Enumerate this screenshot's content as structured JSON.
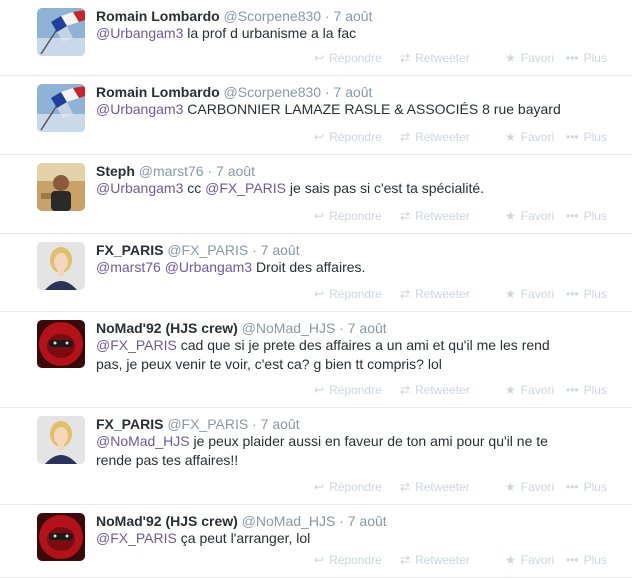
{
  "tweets": [
    {
      "name": "Romain Lombardo",
      "handle": "@Scorpene830",
      "date": "7 août",
      "avatar": "flag-france-avatar",
      "text": [
        {
          "t": "@Urbangam3",
          "m": true
        },
        {
          "t": " la prof d urbanisme a la fac",
          "m": false
        }
      ]
    },
    {
      "name": "Romain Lombardo",
      "handle": "@Scorpene830",
      "date": "7 août",
      "avatar": "flag-france-avatar",
      "text": [
        {
          "t": "@Urbangam3",
          "m": true
        },
        {
          "t": " CARBONNIER LAMAZE RASLE & ASSOCIÉS 8 rue bayard",
          "m": false
        }
      ]
    },
    {
      "name": "Steph",
      "handle": "@marst76",
      "date": "7 août",
      "avatar": "person-photo-avatar",
      "text": [
        {
          "t": "@Urbangam3",
          "m": true
        },
        {
          "t": " cc ",
          "m": false
        },
        {
          "t": "@FX_PARIS",
          "m": true
        },
        {
          "t": " je sais pas si c'est ta spécialité.",
          "m": false
        }
      ]
    },
    {
      "name": "FX_PARIS",
      "handle": "@FX_PARIS",
      "date": "7 août",
      "avatar": "blonde-woman-avatar",
      "text": [
        {
          "t": "@marst76",
          "m": true
        },
        {
          "t": " ",
          "m": false
        },
        {
          "t": "@Urbangam3",
          "m": true
        },
        {
          "t": " Droit des affaires.",
          "m": false
        }
      ]
    },
    {
      "name": "NoMad'92 (HJS crew)",
      "handle": "@NoMad_HJS",
      "date": "7 août",
      "avatar": "red-keffiyeh-avatar",
      "text": [
        {
          "t": "@FX_PARIS",
          "m": true
        },
        {
          "t": " cad que si je prete des affaires a un ami et qu'il me les rend pas, je peux venir te voir, c'est ca? g bien tt compris? lol",
          "m": false
        }
      ]
    },
    {
      "name": "FX_PARIS",
      "handle": "@FX_PARIS",
      "date": "7 août",
      "avatar": "blonde-woman-avatar",
      "text": [
        {
          "t": "@NoMad_HJS",
          "m": true
        },
        {
          "t": " je peux plaider aussi en faveur de ton ami pour qu'il ne te rende pas tes affaires!!",
          "m": false
        }
      ]
    },
    {
      "name": "NoMad'92 (HJS crew)",
      "handle": "@NoMad_HJS",
      "date": "7 août",
      "avatar": "red-keffiyeh-avatar",
      "text": [
        {
          "t": "@FX_PARIS",
          "m": true
        },
        {
          "t": " ça peut l'arranger, lol",
          "m": false
        }
      ]
    }
  ],
  "actions": {
    "reply": "Répondre",
    "retweet": "Retweeter",
    "favorite": "Favori",
    "more": "Plus",
    "reply_icon": "reply-arrow-icon",
    "retweet_icon": "retweet-arrows-icon",
    "favorite_icon": "star-icon",
    "more_icon": "dots-icon"
  },
  "colors": {
    "name": "#292f33",
    "meta": "#8899a6",
    "mention": "#6f5a98",
    "action": "#ccd6dd",
    "divider": "#e8e8e8"
  }
}
